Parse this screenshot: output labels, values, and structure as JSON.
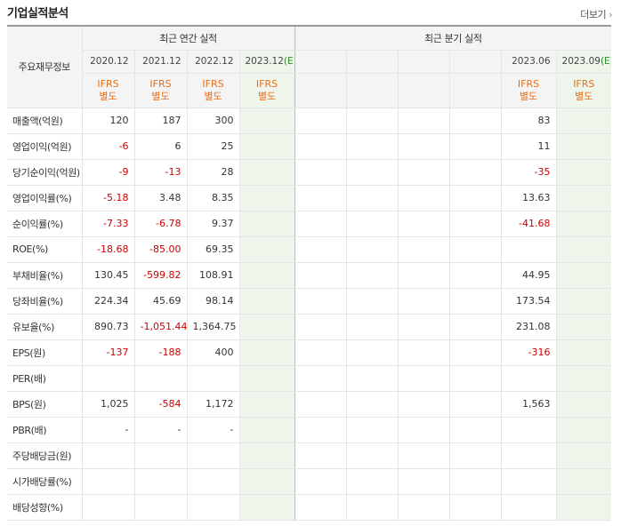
{
  "header": {
    "title": "기업실적분석",
    "more_label": "더보기"
  },
  "table": {
    "corner_label": "주요재무정보",
    "annual_header": "최근 연간 실적",
    "quarter_header": "최근 분기 실적",
    "annual_periods": [
      {
        "label": "2020.12",
        "std": "IFRS",
        "type": "별도"
      },
      {
        "label": "2021.12",
        "std": "IFRS",
        "type": "별도"
      },
      {
        "label": "2022.12",
        "std": "IFRS",
        "type": "별도"
      },
      {
        "label": "2023.12",
        "est": "(E)",
        "std": "IFRS",
        "type": "별도"
      }
    ],
    "quarter_periods": [
      {
        "label": "",
        "std": "",
        "type": ""
      },
      {
        "label": "",
        "std": "",
        "type": ""
      },
      {
        "label": "",
        "std": "",
        "type": ""
      },
      {
        "label": "",
        "std": "",
        "type": ""
      },
      {
        "label": "2023.06",
        "std": "IFRS",
        "type": "별도"
      },
      {
        "label": "2023.09",
        "est": "(E)",
        "std": "IFRS",
        "type": "별도"
      }
    ],
    "rows": [
      {
        "label": "매출액(억원)",
        "group_start": true,
        "annual": [
          "120",
          "187",
          "300",
          ""
        ],
        "quarter": [
          "",
          "",
          "",
          "",
          "83",
          ""
        ]
      },
      {
        "label": "영업이익(억원)",
        "annual": [
          "-6",
          "6",
          "25",
          ""
        ],
        "quarter": [
          "",
          "",
          "",
          "",
          "11",
          ""
        ]
      },
      {
        "label": "당기순이익(억원)",
        "annual": [
          "-9",
          "-13",
          "28",
          ""
        ],
        "quarter": [
          "",
          "",
          "",
          "",
          "-35",
          ""
        ]
      },
      {
        "label": "영업이익률(%)",
        "group_start": true,
        "annual": [
          "-5.18",
          "3.48",
          "8.35",
          ""
        ],
        "quarter": [
          "",
          "",
          "",
          "",
          "13.63",
          ""
        ]
      },
      {
        "label": "순이익률(%)",
        "annual": [
          "-7.33",
          "-6.78",
          "9.37",
          ""
        ],
        "quarter": [
          "",
          "",
          "",
          "",
          "-41.68",
          ""
        ]
      },
      {
        "label": "ROE(%)",
        "annual": [
          "-18.68",
          "-85.00",
          "69.35",
          ""
        ],
        "quarter": [
          "",
          "",
          "",
          "",
          "",
          ""
        ]
      },
      {
        "label": "부채비율(%)",
        "group_start": true,
        "annual": [
          "130.45",
          "-599.82",
          "108.91",
          ""
        ],
        "quarter": [
          "",
          "",
          "",
          "",
          "44.95",
          ""
        ]
      },
      {
        "label": "당좌비율(%)",
        "annual": [
          "224.34",
          "45.69",
          "98.14",
          ""
        ],
        "quarter": [
          "",
          "",
          "",
          "",
          "173.54",
          ""
        ]
      },
      {
        "label": "유보율(%)",
        "annual": [
          "890.73",
          "-1,051.44",
          "1,364.75",
          ""
        ],
        "quarter": [
          "",
          "",
          "",
          "",
          "231.08",
          ""
        ]
      },
      {
        "label": "EPS(원)",
        "group_start": true,
        "annual": [
          "-137",
          "-188",
          "400",
          ""
        ],
        "quarter": [
          "",
          "",
          "",
          "",
          "-316",
          ""
        ]
      },
      {
        "label": "PER(배)",
        "annual": [
          "",
          "",
          "",
          ""
        ],
        "quarter": [
          "",
          "",
          "",
          "",
          "",
          ""
        ]
      },
      {
        "label": "BPS(원)",
        "annual": [
          "1,025",
          "-584",
          "1,172",
          ""
        ],
        "quarter": [
          "",
          "",
          "",
          "",
          "1,563",
          ""
        ]
      },
      {
        "label": "PBR(배)",
        "annual": [
          "-",
          "-",
          "-",
          ""
        ],
        "quarter": [
          "",
          "",
          "",
          "",
          "",
          ""
        ]
      },
      {
        "label": "주당배당금(원)",
        "group_start": true,
        "annual": [
          "",
          "",
          "",
          ""
        ],
        "quarter": [
          "",
          "",
          "",
          "",
          "",
          ""
        ]
      },
      {
        "label": "시가배당률(%)",
        "annual": [
          "",
          "",
          "",
          ""
        ],
        "quarter": [
          "",
          "",
          "",
          "",
          "",
          ""
        ]
      },
      {
        "label": "배당성향(%)",
        "annual": [
          "",
          "",
          "",
          ""
        ],
        "quarter": [
          "",
          "",
          "",
          "",
          "",
          ""
        ]
      }
    ]
  },
  "colors": {
    "negative": "#cc0000",
    "ifrs": "#e8701a",
    "estimate_bg": "#f2faf0"
  }
}
